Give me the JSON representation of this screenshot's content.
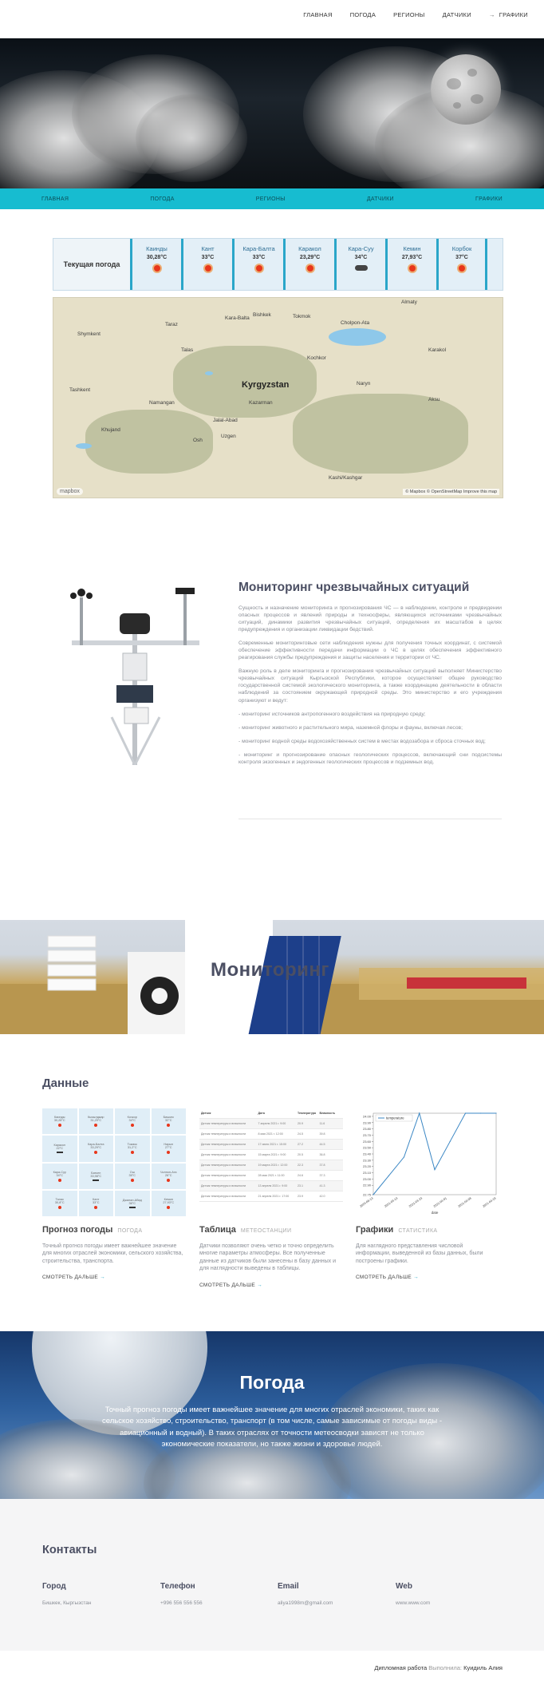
{
  "topnav": {
    "items": [
      "ГЛАВНАЯ",
      "ПОГОДА",
      "РЕГИОНЫ",
      "ДАТЧИКИ",
      "ГРАФИКИ"
    ]
  },
  "subnav": {
    "items": [
      "ГЛАВНАЯ",
      "ПОГОДА",
      "РЕГИОНЫ",
      "ДАТЧИКИ",
      "ГРАФИКИ"
    ]
  },
  "weather_strip": {
    "title": "Текущая погода",
    "cities": [
      {
        "name": "Каинды",
        "temp": "30,28°C",
        "icon": "sun-icon"
      },
      {
        "name": "Кант",
        "temp": "33°C",
        "icon": "sun-icon"
      },
      {
        "name": "Кара-Балта",
        "temp": "33°C",
        "icon": "sun-icon"
      },
      {
        "name": "Каракол",
        "temp": "23,29°C",
        "icon": "sun-icon"
      },
      {
        "name": "Кара-Суу",
        "temp": "34°C",
        "icon": "cloud-icon"
      },
      {
        "name": "Кемин",
        "temp": "27,93°C",
        "icon": "sun-icon"
      },
      {
        "name": "Корбок",
        "temp": "37°C",
        "icon": "sun-icon"
      }
    ]
  },
  "map": {
    "country": "Kyrgyzstan",
    "labels": [
      "Bishkek",
      "Almaty",
      "Taraz",
      "Kara-Balta",
      "Tokmok",
      "Cholpon-Ata",
      "Karakol",
      "Naryn",
      "Kazarman",
      "Jalal-Abad",
      "Osh",
      "Uzgen",
      "Kashi/Kashgar",
      "Shymkent",
      "Tashkent",
      "Namangan",
      "Aksu",
      "Khujand",
      "Talas",
      "Kochkor"
    ],
    "attribution": "© Mapbox © OpenStreetMap  Improve this map",
    "logo": "mapbox"
  },
  "monitoring": {
    "title": "Мониторинг чрезвычайных ситуаций",
    "paragraphs": [
      "Сущность и назначение мониторинга и прогнозирования ЧС — в наблюдении, контроле и предвидении опасных процессов и явлений природы и техносферы, являющихся источниками чрезвычайных ситуаций, динамики развития чрезвычайных ситуаций, определения их масштабов в целях предупреждения и организации ликвидации бедствий.",
      "Современные мониторинговые сети наблюдения нужны для получения точных координат, с системой обеспечение эффективности передачи информации о ЧС в целях обеспечения эффективного реагирования службы предупреждения и защиты населения и территории от ЧС.",
      "Важную роль в деле мониторинга и прогнозирования чрезвычайных ситуаций выполняет Министерство чрезвычайных ситуаций Кыргызской Республики, которое осуществляет общее руководство государственной системой экологического мониторинга, а также координацию деятельности в области наблюдений за состоянием окружающей природной среды. Это министерство и его учреждения организуют и ведут:",
      "- мониторинг источников антропогенного воздействия на природную среду;",
      "- мониторинг животного и растительного мира, наземной флоры и фауны, включая лесов;",
      "- мониторинг водной среды водохозяйственных систем в местах водозабора и сброса сточных вод;",
      "- мониторинг и прогнозирование опасных геологических процессов, включающий сни подсистемы контроля экзогенных и эндогенных геологических процессов и подземных вод."
    ]
  },
  "banner": {
    "text": "Мониторинг"
  },
  "data_section": {
    "title": "Данные",
    "cards": [
      {
        "title": "Прогноз погоды",
        "sub": "ПОГОДА",
        "text": "Точный прогноз погоды имеет важнейшее значение для многих отраслей экономики, сельского хозяйства, строительства, транспорта.",
        "more": "СМОТРЕТЬ ДАЛЬШЕ"
      },
      {
        "title": "Таблица",
        "sub": "МЕТЕОСТАНЦИИ",
        "text": "Датчики позволяют очень четко и точно определить многие параметры атмосферы. Все полученные данные из датчиков были занесены в базу данных и для наглядности выведены в таблицы.",
        "more": "СМОТРЕТЬ ДАЛЬШЕ"
      },
      {
        "title": "Графики",
        "sub": "СТАТИСТИКА",
        "text": "Для наглядного представления числовой информации, выведенной из базы данных, были построены графики.",
        "more": "СМОТРЕТЬ ДАЛЬШЕ"
      }
    ],
    "mini_table_cells": [
      [
        "Каинды",
        "30,28°C"
      ],
      [
        "Кызылджар",
        "31,29°C"
      ],
      [
        "Кочкор",
        "34°C"
      ],
      [
        "Бишкек",
        "32°C"
      ],
      [
        "Каракол",
        "22°C"
      ],
      [
        "Кара-Балта",
        "33,29°C"
      ],
      [
        "Токмок",
        "31,2°C"
      ],
      [
        "Нарын",
        "27°C"
      ],
      [
        "Кара-Суу",
        "34°C"
      ],
      [
        "Баткен",
        "33,98°C"
      ],
      [
        "Ош",
        "35°C"
      ],
      [
        "Чолпон-Ата",
        "26°C"
      ],
      [
        "Талас",
        "30,8°C"
      ],
      [
        "Кант",
        "33°C"
      ],
      [
        "Джалал-Абад",
        "36°C"
      ],
      [
        "Кемин",
        "27,93°C"
      ]
    ],
    "list_table": {
      "headers": [
        "Датчик",
        "Дата",
        "Температура",
        "Влажность"
      ],
      "rows": [
        [
          "Датчик температуры и влажности",
          "7 апреля 2021 г. 9:00",
          "20.9",
          "11.6"
        ],
        [
          "Датчик температуры и влажности",
          "8 мая 2021 г. 12:00",
          "24.5",
          "39.8"
        ],
        [
          "Датчик температуры и влажности",
          "17 июня 2021 г. 15:00",
          "27.2",
          "44.5"
        ],
        [
          "Датчик температуры и влажности",
          "15 марта 2021 г. 9:00",
          "20.5",
          "36.8"
        ],
        [
          "Датчик температуры и влажности",
          "19 марта 2021 г. 12:00",
          "22.3",
          "37.8"
        ],
        [
          "Датчик температуры и влажности",
          "28 мая 2021 г. 11:00",
          "24.6",
          "37.3"
        ],
        [
          "Датчик температуры и влажности",
          "13 апреля 2021 г. 9:00",
          "23.1",
          "41.3"
        ],
        [
          "Датчик температуры и влажности",
          "21 апреля 2021 г. 17:00",
          "23.9",
          "42.0"
        ]
      ]
    }
  },
  "chart_data": {
    "type": "line",
    "series": [
      {
        "name": "temperature",
        "values": [
          22.75,
          23.05,
          23.35,
          24.05,
          23.15,
          23.6,
          24.05,
          24.05,
          24.05
        ]
      }
    ],
    "x": [
      "2020-06-13",
      "2021-03-09",
      "2021-03-25",
      "2021-03-27",
      "2021-04-09",
      "2021-05-14",
      "2021-06-07",
      "2021-06-27",
      "2021-06-30"
    ],
    "x_tick_labels": [
      "2020-06-13",
      "2021-03-13",
      "2021-03-23",
      "2021-04-01",
      "2021-04-08",
      "2021-04-19"
    ],
    "ylim": [
      22.75,
      24.05
    ],
    "y_ticks": [
      22.75,
      22.9,
      23.0,
      23.1,
      23.2,
      23.3,
      23.4,
      23.5,
      23.6,
      23.7,
      23.8,
      23.9,
      24.0
    ],
    "xlabel": "date",
    "ylabel": "",
    "grid": false,
    "legend": "top-left",
    "color": "#3b87c4"
  },
  "weather_hero": {
    "title": "Погода",
    "text": "Точный прогноз погоды имеет важнейшее значение для многих отраслей экономики, таких как сельское хозяйство, строительство, транспорт (в том числе, самые зависимые от погоды виды - авиационный и водный). В таких отраслях от точности метеосводки зависят не только экономические показатели, но также жизни и здоровье людей."
  },
  "contacts": {
    "title": "Контакты",
    "columns": [
      {
        "head": "Город",
        "value": "Бишкек, Кыргызстан"
      },
      {
        "head": "Телефон",
        "value": "+996 556 556 556"
      },
      {
        "head": "Email",
        "value": "aliya1998m@gmail.com"
      },
      {
        "head": "Web",
        "value": "www.www.com"
      }
    ]
  },
  "footer": {
    "prefix": "Дипломная работа",
    "mid": "Выполнила:",
    "name": "Куидиль Алия"
  },
  "colors": {
    "accent": "#17bcd0",
    "strip_border": "#2aa6c9",
    "heading": "#4b4f63",
    "sun": "#e8361b"
  }
}
